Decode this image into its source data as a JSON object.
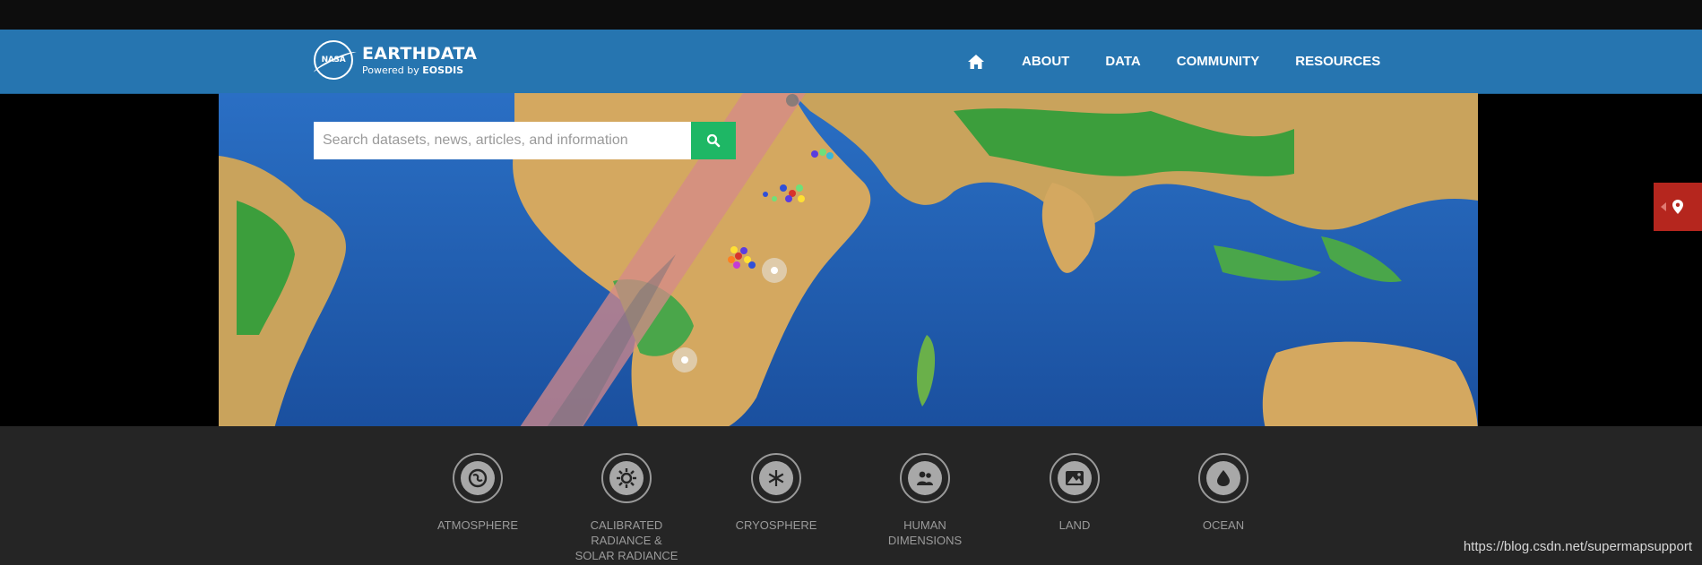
{
  "header": {
    "logo_text": "NASA",
    "brand_title": "EARTHDATA",
    "brand_sub_prefix": "Powered by ",
    "brand_sub_strong": "EOSDIS",
    "nav": [
      {
        "label": "ABOUT"
      },
      {
        "label": "DATA"
      },
      {
        "label": "COMMUNITY"
      },
      {
        "label": "RESOURCES"
      }
    ]
  },
  "search": {
    "placeholder": "Search datasets, news, articles, and information",
    "value": ""
  },
  "categories": [
    {
      "lines": [
        "ATMOSPHERE"
      ],
      "icon": "atmosphere-icon"
    },
    {
      "lines": [
        "CALIBRATED",
        "RADIANCE &",
        "SOLAR RADIANCE"
      ],
      "icon": "calibrated-radiance-icon"
    },
    {
      "lines": [
        "CRYOSPHERE"
      ],
      "icon": "cryosphere-icon"
    },
    {
      "lines": [
        "HUMAN",
        "DIMENSIONS"
      ],
      "icon": "human-dimensions-icon"
    },
    {
      "lines": [
        "LAND"
      ],
      "icon": "land-icon"
    },
    {
      "lines": [
        "OCEAN"
      ],
      "icon": "ocean-icon"
    }
  ],
  "credit": "https://blog.csdn.net/supermapsupport",
  "colors": {
    "header": "#2675b0",
    "search_button": "#1eb765",
    "side_tab": "#b5261e",
    "footer": "#252525"
  }
}
